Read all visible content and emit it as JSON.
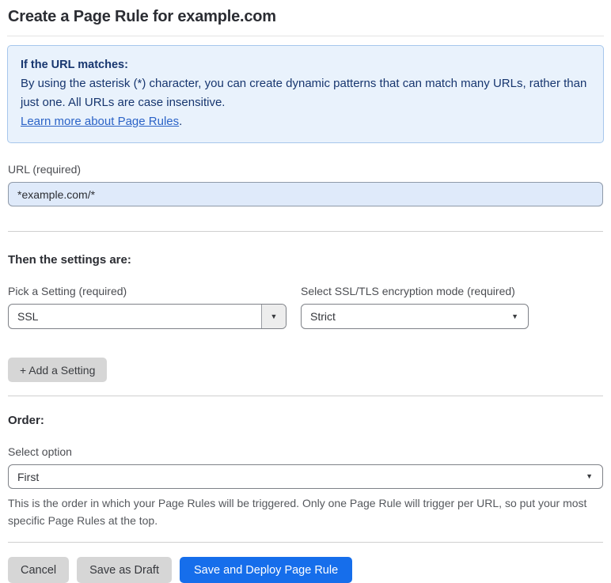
{
  "page_title": "Create a Page Rule for example.com",
  "info_box": {
    "heading": "If the URL matches:",
    "body": "By using the asterisk (*) character, you can create dynamic patterns that can match many URLs, rather than just one. All URLs are case insensitive.",
    "link_label": "Learn more about Page Rules",
    "link_suffix": "."
  },
  "form": {
    "url": {
      "label": "URL (required)",
      "value": "*example.com/*"
    },
    "settings": {
      "heading": "Then the settings are:",
      "pick_setting": {
        "label": "Pick a Setting (required)",
        "value": "SSL"
      },
      "ssl_mode": {
        "label": "Select SSL/TLS encryption mode (required)",
        "value": "Strict"
      },
      "add_setting_button": "+ Add a Setting"
    },
    "order": {
      "heading": "Order:",
      "select_label": "Select option",
      "value": "First",
      "description": "This is the order in which your Page Rules will be triggered. Only one Page Rule will trigger per URL, so put your most specific Page Rules at the top."
    }
  },
  "actions": {
    "cancel": "Cancel",
    "save_draft": "Save as Draft",
    "save_deploy": "Save and Deploy Page Rule"
  },
  "icons": {
    "chevron_down": "▼"
  },
  "colors": {
    "accent-blue": "#166eeb",
    "info-bg": "#e9f2fc",
    "info-border": "#a7c7ec",
    "info-text": "#17366f",
    "link-blue": "#2b63c7",
    "input-bg": "#dfeafa",
    "button-gray": "#d6d6d6",
    "divider": "#cfcfcf"
  }
}
